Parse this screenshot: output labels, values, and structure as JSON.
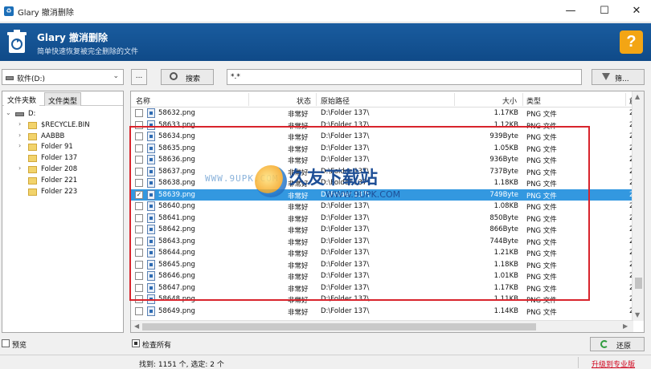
{
  "window": {
    "title": "Glary 撤消删除",
    "minimize": "—",
    "maximize": "☐",
    "close": "✕"
  },
  "banner": {
    "app_name": "Glary 撤消删除",
    "subtitle": "简单快速恢复被完全删除的文件",
    "help": "?"
  },
  "toolbar": {
    "drive": "软件(D:)",
    "browse": "...",
    "search_label": "搜索",
    "pattern": "*.*",
    "filter_label": "筛..."
  },
  "left_panel": {
    "tabs": [
      "文件夹数",
      "文件类型"
    ],
    "tree": [
      {
        "label": "D:",
        "toggle": "⌄",
        "kind": "drive"
      },
      {
        "label": "$RECYCLE.BIN",
        "toggle": "›",
        "kind": "folder"
      },
      {
        "label": "AABBB",
        "toggle": "›",
        "kind": "folder"
      },
      {
        "label": "Folder 91",
        "toggle": "›",
        "kind": "folder"
      },
      {
        "label": "Folder 137",
        "toggle": "",
        "kind": "folder"
      },
      {
        "label": "Folder 208",
        "toggle": "›",
        "kind": "folder"
      },
      {
        "label": "Folder 221",
        "toggle": "",
        "kind": "folder"
      },
      {
        "label": "Folder 223",
        "toggle": "",
        "kind": "folder"
      }
    ]
  },
  "list": {
    "columns": [
      "名称",
      "状态",
      "原始路径",
      "大小",
      "类型",
      "創"
    ],
    "rows": [
      {
        "name": "58632.png",
        "state": "非常好",
        "path": "D:\\Folder 137\\",
        "size": "1.17KB",
        "type": "PNG 文件",
        "extra": "2",
        "checked": false
      },
      {
        "name": "58633.png",
        "state": "非常好",
        "path": "D:\\Folder 137\\",
        "size": "1.12KB",
        "type": "PNG 文件",
        "extra": "2",
        "checked": false
      },
      {
        "name": "58634.png",
        "state": "非常好",
        "path": "D:\\Folder 137\\",
        "size": "939Byte",
        "type": "PNG 文件",
        "extra": "2",
        "checked": false
      },
      {
        "name": "58635.png",
        "state": "非常好",
        "path": "D:\\Folder 137\\",
        "size": "1.05KB",
        "type": "PNG 文件",
        "extra": "2",
        "checked": false
      },
      {
        "name": "58636.png",
        "state": "非常好",
        "path": "D:\\Folder 137\\",
        "size": "936Byte",
        "type": "PNG 文件",
        "extra": "2",
        "checked": false
      },
      {
        "name": "58637.png",
        "state": "非常好",
        "path": "D:\\Folder 137\\",
        "size": "737Byte",
        "type": "PNG 文件",
        "extra": "2",
        "checked": false
      },
      {
        "name": "58638.png",
        "state": "非常好",
        "path": "D:\\Folder 137\\",
        "size": "1.18KB",
        "type": "PNG 文件",
        "extra": "2",
        "checked": false
      },
      {
        "name": "58639.png",
        "state": "非常好",
        "path": "D:\\Folder 137\\",
        "size": "749Byte",
        "type": "PNG 文件",
        "extra": "2",
        "checked": true
      },
      {
        "name": "58640.png",
        "state": "非常好",
        "path": "D:\\Folder 137\\",
        "size": "1.08KB",
        "type": "PNG 文件",
        "extra": "2",
        "checked": false
      },
      {
        "name": "58641.png",
        "state": "非常好",
        "path": "D:\\Folder 137\\",
        "size": "850Byte",
        "type": "PNG 文件",
        "extra": "2",
        "checked": false
      },
      {
        "name": "58642.png",
        "state": "非常好",
        "path": "D:\\Folder 137\\",
        "size": "866Byte",
        "type": "PNG 文件",
        "extra": "2",
        "checked": false
      },
      {
        "name": "58643.png",
        "state": "非常好",
        "path": "D:\\Folder 137\\",
        "size": "744Byte",
        "type": "PNG 文件",
        "extra": "2",
        "checked": false
      },
      {
        "name": "58644.png",
        "state": "非常好",
        "path": "D:\\Folder 137\\",
        "size": "1.21KB",
        "type": "PNG 文件",
        "extra": "2",
        "checked": false
      },
      {
        "name": "58645.png",
        "state": "非常好",
        "path": "D:\\Folder 137\\",
        "size": "1.18KB",
        "type": "PNG 文件",
        "extra": "2",
        "checked": false
      },
      {
        "name": "58646.png",
        "state": "非常好",
        "path": "D:\\Folder 137\\",
        "size": "1.01KB",
        "type": "PNG 文件",
        "extra": "2",
        "checked": false
      },
      {
        "name": "58647.png",
        "state": "非常好",
        "path": "D:\\Folder 137\\",
        "size": "1.17KB",
        "type": "PNG 文件",
        "extra": "2",
        "checked": false
      },
      {
        "name": "58648.png",
        "state": "非常好",
        "path": "D:\\Folder 137\\",
        "size": "1.11KB",
        "type": "PNG 文件",
        "extra": "2",
        "checked": false
      },
      {
        "name": "58649.png",
        "state": "非常好",
        "path": "D:\\Folder 137\\",
        "size": "1.14KB",
        "type": "PNG 文件",
        "extra": "2",
        "checked": false
      }
    ],
    "selected_row": "58639.png"
  },
  "watermark": {
    "url": "WWW.9UPK.COM",
    "title": "久友下载站",
    "subtitle": "WWW.9UPK.COM"
  },
  "bottom": {
    "preview_label": "预览",
    "check_all_label": "检查所有",
    "restore_label": "还原"
  },
  "status": {
    "found": "找到: 1151 个, 选定: 2 个",
    "upgrade": "升级到专业版"
  },
  "colors": {
    "banner": "#1a5c9f",
    "selection": "#3398e0",
    "highlight_box": "#d8242c",
    "help_button": "#f3a514"
  }
}
